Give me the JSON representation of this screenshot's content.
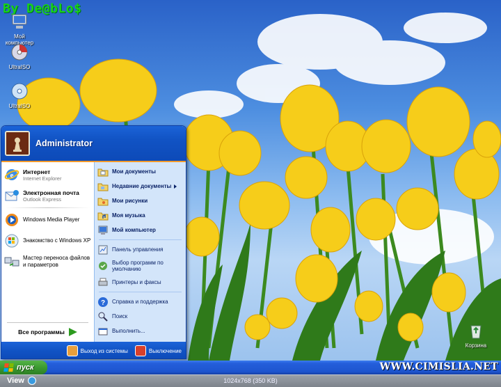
{
  "watermark": "By De@bLo$",
  "desktop_icons": [
    {
      "label": "Мой компьютер",
      "icon": "my-computer-icon"
    },
    {
      "label": "UltraISO",
      "icon": "ultraiso-disc-icon"
    },
    {
      "label": "UltraISO",
      "icon": "ultraiso-disc-icon"
    },
    {
      "label": "Корзина",
      "icon": "recycle-bin-icon"
    }
  ],
  "start_menu": {
    "user": "Administrator",
    "pinned": [
      {
        "title": "Интернет",
        "subtitle": "Internet Explorer",
        "icon": "internet-explorer-icon"
      },
      {
        "title": "Электронная почта",
        "subtitle": "Outlook Express",
        "icon": "outlook-express-icon"
      }
    ],
    "recent": [
      {
        "label": "Windows Media Player",
        "icon": "media-player-icon"
      },
      {
        "label": "Знакомство с Windows XP",
        "icon": "windows-tour-icon"
      },
      {
        "label": "Мастер переноса файлов и параметров",
        "icon": "transfer-wizard-icon"
      }
    ],
    "all_programs": "Все программы",
    "places": [
      {
        "label": "Мои документы",
        "icon": "folder-documents-icon",
        "bold": true
      },
      {
        "label": "Недавние документы",
        "icon": "folder-recent-icon",
        "bold": true,
        "submenu": true
      },
      {
        "label": "Мои рисунки",
        "icon": "folder-pictures-icon",
        "bold": true
      },
      {
        "label": "Моя музыка",
        "icon": "folder-music-icon",
        "bold": true
      },
      {
        "label": "Мой компьютер",
        "icon": "computer-icon",
        "bold": true
      }
    ],
    "system": [
      {
        "label": "Панель управления",
        "icon": "control-panel-icon"
      },
      {
        "label": "Выбор программ по умолчанию",
        "icon": "default-programs-icon"
      },
      {
        "label": "Принтеры и факсы",
        "icon": "printer-icon"
      }
    ],
    "help": [
      {
        "label": "Справка и поддержка",
        "icon": "help-icon"
      },
      {
        "label": "Поиск",
        "icon": "search-icon"
      },
      {
        "label": "Выполнить...",
        "icon": "run-icon"
      }
    ],
    "logoff": "Выход из системы",
    "shutdown": "Выключение"
  },
  "taskbar": {
    "start_label": "пуск",
    "site": "WWW.CIMISLIA.NET"
  },
  "viewer": {
    "view_label": "View",
    "image_info": "1024x768 (350 KB)"
  },
  "colors": {
    "xp_blue": "#1153c4",
    "start_green": "#3b9a31",
    "accent_orange": "#f39a2b",
    "places_bg": "#d3e5fa",
    "watermark_green": "#19d119"
  }
}
